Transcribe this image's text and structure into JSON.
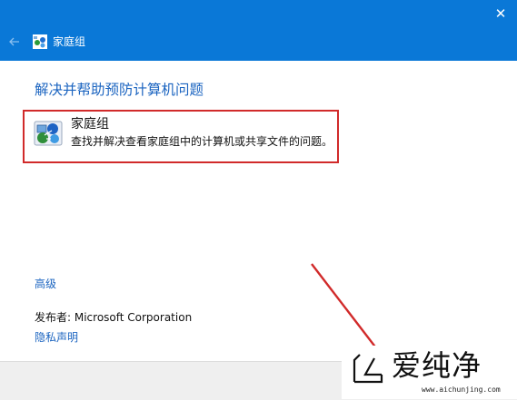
{
  "window": {
    "title": "家庭组",
    "back_icon": "back-arrow-icon",
    "close_icon": "close-icon",
    "titlebar_color": "#0a78d7"
  },
  "main": {
    "heading": "解决并帮助预防计算机问题",
    "item": {
      "title": "家庭组",
      "description": "查找并解决查看家庭组中的计算机或共享文件的问题。",
      "icon": "homegroup-icon"
    },
    "advanced_link": "高级",
    "publisher": "发布者: Microsoft Corporation",
    "privacy_link": "隐私声明"
  },
  "watermark": {
    "brand": "爱纯净",
    "url": "www.aichunjing.com"
  },
  "annotations": {
    "highlight_color": "#d12a2a"
  }
}
